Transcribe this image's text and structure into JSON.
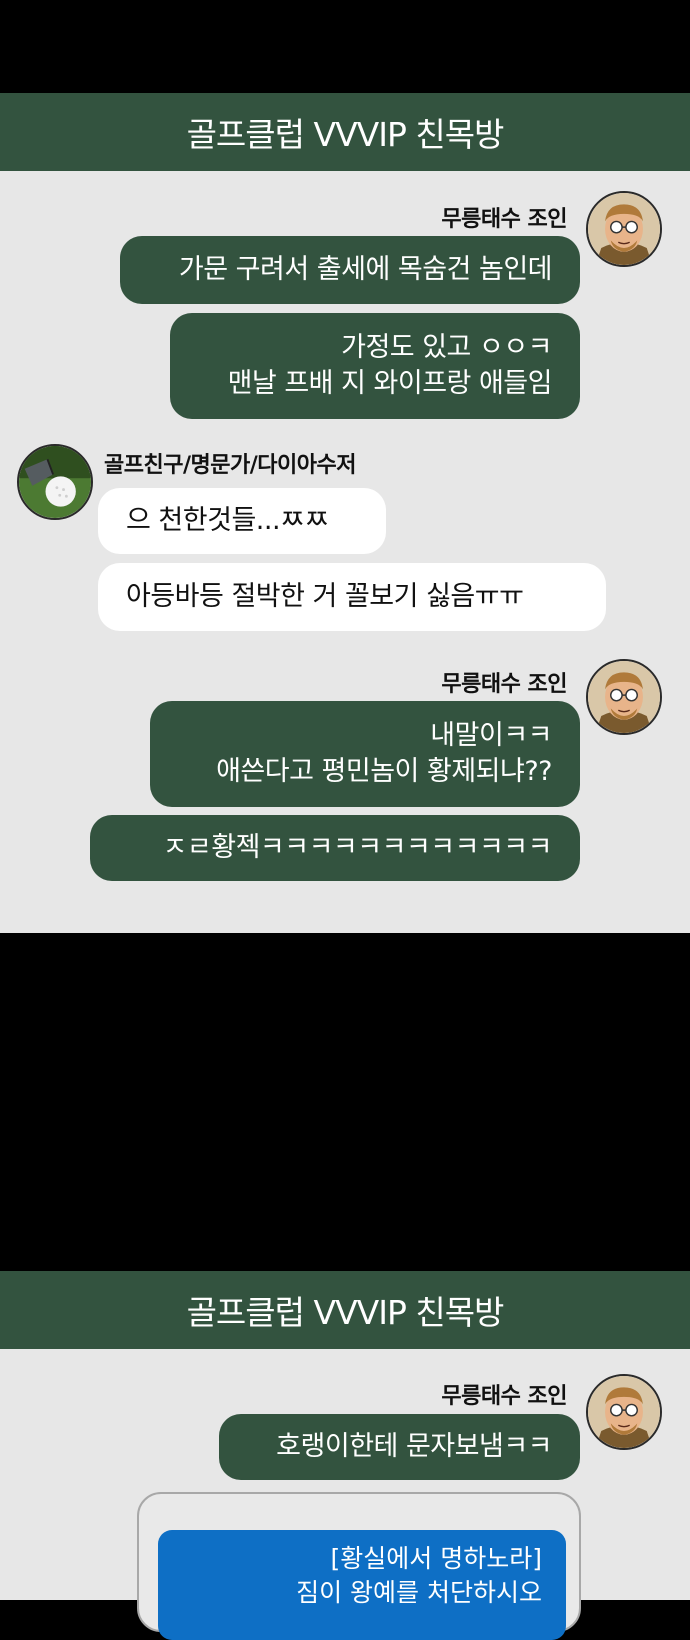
{
  "colors": {
    "header_bg": "#33533f",
    "chat_bg": "#e7e7e7",
    "my_bubble": "#33533f",
    "friend_bubble": "#ffffff",
    "sms_bubble": "#0e6fc5",
    "gap": "#000000"
  },
  "panels": [
    {
      "header_title": "골프클럽 VVVIP 친목방",
      "messages": [
        {
          "sender": "무릉태수 조인",
          "avatar": "bearded-man-glasses-avatar",
          "side": "right",
          "bubbles": [
            {
              "lines": [
                "가문 구려서 출세에 목숨건 놈인데"
              ]
            },
            {
              "lines": [
                "가정도 있고 ㅇㅇㅋ",
                "맨날 프배 지 와이프랑 애들임"
              ]
            }
          ]
        },
        {
          "sender": "골프친구/명문가/다이아수저",
          "avatar": "golf-ball-avatar",
          "side": "left",
          "bubbles": [
            {
              "lines": [
                "으 천한것들...ㅉㅉ"
              ]
            },
            {
              "lines": [
                "아등바등 절박한 거 꼴보기 싫음ㅠㅠ"
              ]
            }
          ]
        },
        {
          "sender": "무릉태수 조인",
          "avatar": "bearded-man-glasses-avatar",
          "side": "right",
          "bubbles": [
            {
              "lines": [
                "내말이ㅋㅋ",
                "애쓴다고 평민놈이 황제되냐??"
              ]
            },
            {
              "lines": [
                "ㅈㄹ황젝ㅋㅋㅋㅋㅋㅋㅋㅋㅋㅋㅋㅋ"
              ]
            }
          ]
        }
      ]
    },
    {
      "header_title": "골프클럽 VVVIP 친목방",
      "messages": [
        {
          "sender": "무릉태수 조인",
          "avatar": "bearded-man-glasses-avatar",
          "side": "right",
          "bubbles": [
            {
              "lines": [
                "호랭이한테 문자보냄ㅋㅋ"
              ]
            }
          ]
        }
      ],
      "sms": {
        "lines": [
          "[황실에서 명하노라]",
          "짐이 왕예를 처단하시오"
        ]
      }
    }
  ]
}
